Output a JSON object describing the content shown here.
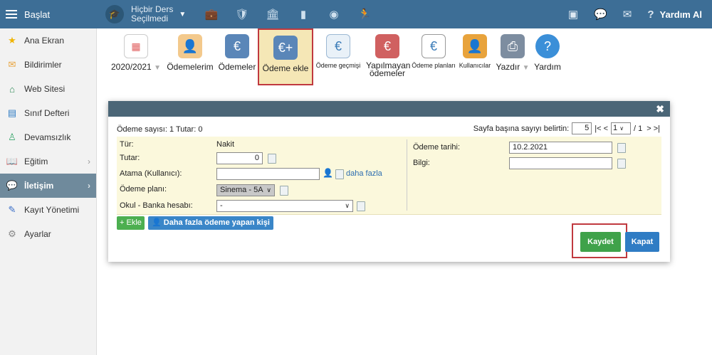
{
  "topbar": {
    "menu_label": "Başlat",
    "course_line1": "Hiçbir Ders",
    "course_line2": "Seçilmedi",
    "icons": [
      "briefcase-icon",
      "shield-icon",
      "institution-icon",
      "bar-chart-icon",
      "palette-icon",
      "activity-icon"
    ],
    "help_label": "Yardım Al"
  },
  "sidebar": {
    "items": [
      {
        "label": "Ana Ekran",
        "icon": "star-icon",
        "color": "#f0b400"
      },
      {
        "label": "Bildirimler",
        "icon": "envelope-icon",
        "color": "#e8a33c"
      },
      {
        "label": "Web Sitesi",
        "icon": "home-icon",
        "color": "#2e8b57"
      },
      {
        "label": "Sınıf Defteri",
        "icon": "notebook-icon",
        "color": "#2f7cc4"
      },
      {
        "label": "Devamsızlık",
        "icon": "person-icon",
        "color": "#3aa76d"
      },
      {
        "label": "Eğitim",
        "icon": "book-icon",
        "color": "#2f7cc4"
      },
      {
        "label": "İletişim",
        "icon": "chat-icon",
        "color": "#ffffff"
      },
      {
        "label": "Kayıt Yönetimi",
        "icon": "pen-icon",
        "color": "#3a6ec8"
      },
      {
        "label": "Ayarlar",
        "icon": "gear-icon",
        "color": "#888888"
      }
    ]
  },
  "toolbar": {
    "year": "2020/2021",
    "items": [
      {
        "label": "Ödemelerim",
        "color": "#e8a33c"
      },
      {
        "label": "Ödemeler",
        "color": "#5a86b8"
      },
      {
        "label": "Ödeme ekle",
        "color": "#5a86b8"
      },
      {
        "label": "Ödeme geçmişi",
        "color": "#5a9ad0"
      },
      {
        "label": "Yapılmayan ödemeler",
        "color": "#d06060"
      },
      {
        "label": "Ödeme planları",
        "color": "#5a86b8"
      },
      {
        "label": "Kullanıcılar",
        "color": "#e8a33c"
      },
      {
        "label": "Yazdır",
        "color": "#7d8da0"
      },
      {
        "label": "Yardım",
        "color": "#3b8fd8"
      }
    ]
  },
  "dialog": {
    "info": "Ödeme sayısı: 1   Tutar: 0",
    "pager": {
      "label": "Sayfa başına sayıyı belirtin:",
      "per_page": "5",
      "first_prev": "|< <",
      "page": "1",
      "total": "/ 1",
      "next_last": "> >|"
    },
    "fields": {
      "tur_label": "Tür:",
      "tur_value": "Nakit",
      "tutar_label": "Tutar:",
      "tutar_value": "0",
      "atama_label": "Atama (Kullanıcı):",
      "atama_value": "",
      "daha_fazla": "daha fazla",
      "plan_label": "Ödeme planı:",
      "plan_value": "Sinema - 5A",
      "banka_label": "Okul - Banka hesabı:",
      "banka_value": "-",
      "tarih_label": "Ödeme tarihi:",
      "tarih_value": "10.2.2021",
      "bilgi_label": "Bilgi:",
      "bilgi_value": ""
    },
    "buttons": {
      "add": "+ Ekle",
      "more_payers": "Daha fazla ödeme yapan kişi",
      "save": "Kaydet",
      "close": "Kapat"
    }
  }
}
